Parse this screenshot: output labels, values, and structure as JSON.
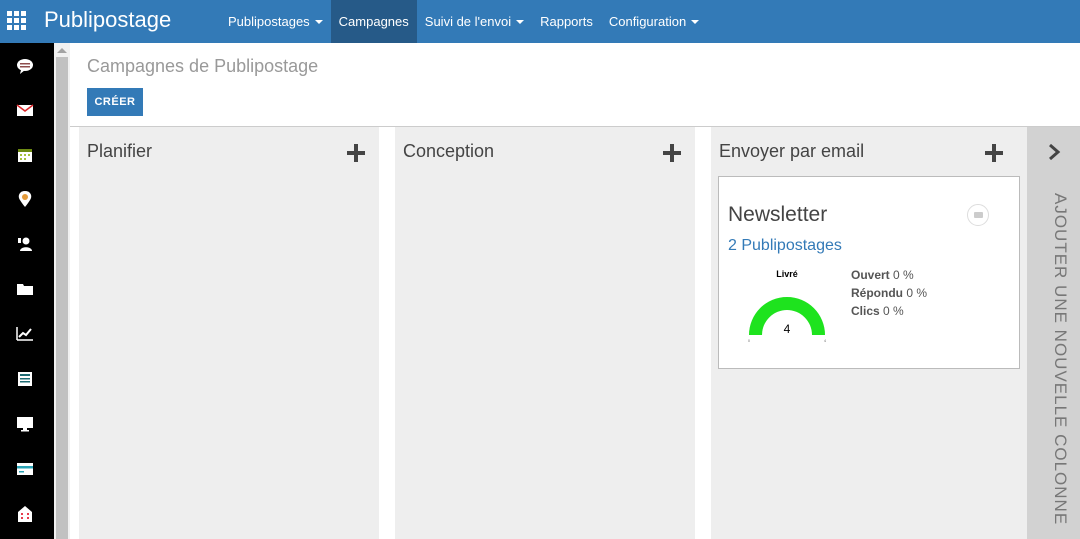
{
  "navbar": {
    "brand": "Publipostage",
    "menu": [
      {
        "label": "Publipostages",
        "dropdown": true,
        "active": false
      },
      {
        "label": "Campagnes",
        "dropdown": false,
        "active": true
      },
      {
        "label": "Suivi de l'envoi",
        "dropdown": true,
        "active": false
      },
      {
        "label": "Rapports",
        "dropdown": false,
        "active": false
      },
      {
        "label": "Configuration",
        "dropdown": true,
        "active": false
      }
    ]
  },
  "apps": [
    {
      "icon": "discuss-icon",
      "color": "#8e4c4c"
    },
    {
      "icon": "mail-icon",
      "color": "#d9262a"
    },
    {
      "icon": "calendar-icon",
      "color": "#a6c23b"
    },
    {
      "icon": "pin-icon",
      "color": "#e59b3a"
    },
    {
      "icon": "contacts-icon",
      "color": "#12888c"
    },
    {
      "icon": "folder-icon",
      "color": "#c42d2d"
    },
    {
      "icon": "trend-icon",
      "color": "#e36d1b"
    },
    {
      "icon": "document-icon",
      "color": "#1e6b73"
    },
    {
      "icon": "monitor-icon",
      "color": "#52595f"
    },
    {
      "icon": "card-icon",
      "color": "#2aa3b5"
    },
    {
      "icon": "building-icon",
      "color": "#e83b4b"
    }
  ],
  "control": {
    "breadcrumb": "Campagnes de Publipostage",
    "create_label": "CRÉER"
  },
  "kanban": {
    "columns": [
      {
        "title": "Planifier"
      },
      {
        "title": "Conception"
      },
      {
        "title": "Envoyer par email"
      }
    ],
    "card": {
      "title": "Newsletter",
      "link": "2 Publipostages",
      "gauge": {
        "label": "Livré",
        "value": "4",
        "min": "0",
        "max": "4",
        "fraction": 1.0,
        "color": "#1ee31e"
      },
      "stats": [
        {
          "label": "Ouvert",
          "value": "0 %"
        },
        {
          "label": "Répondu",
          "value": "0 %"
        },
        {
          "label": "Clics",
          "value": "0 %"
        }
      ]
    },
    "add_column_label": "AJOUTER UNE NOUVELLE COLONNE"
  }
}
